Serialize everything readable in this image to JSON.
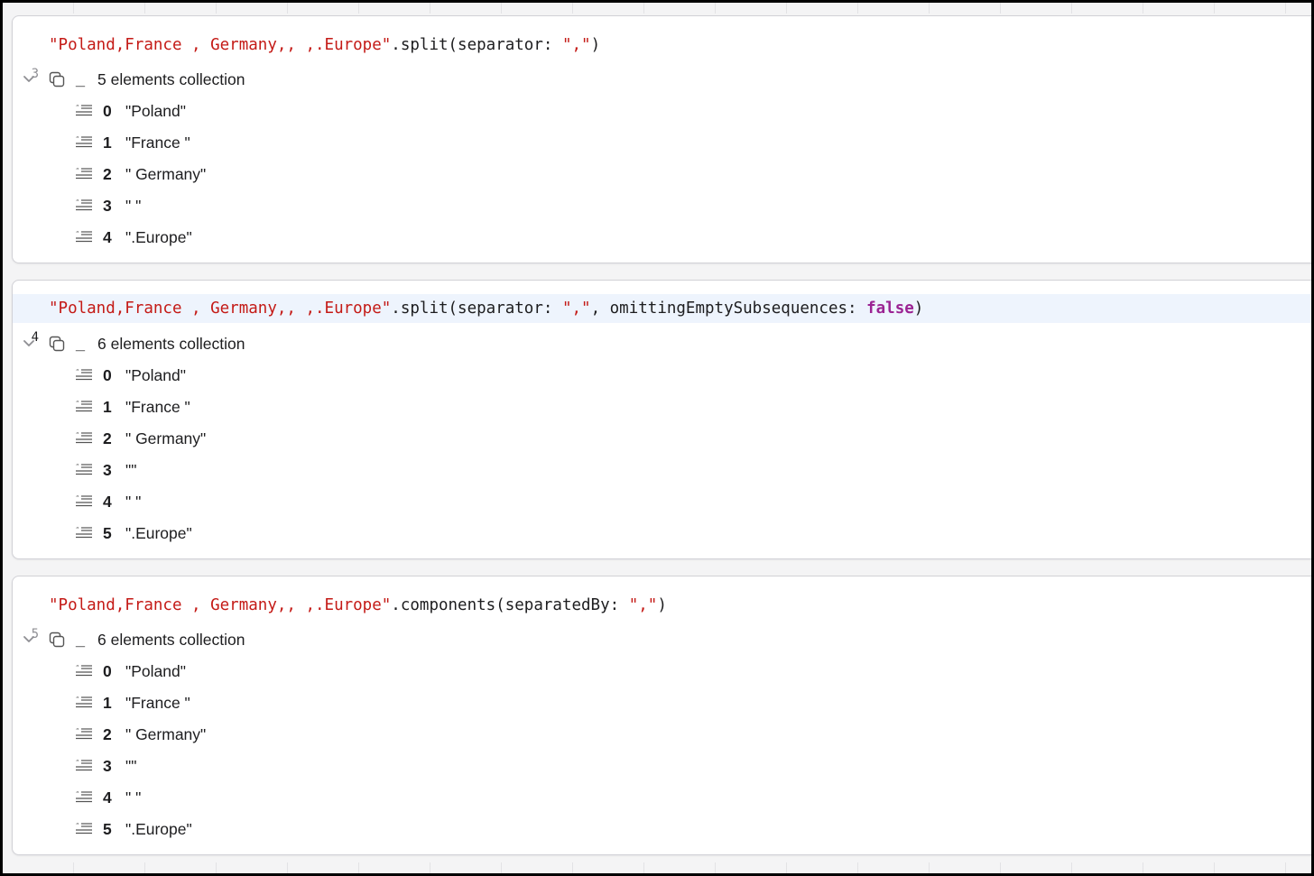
{
  "blocks": [
    {
      "line_number": "3",
      "code": {
        "literal": "\"Poland,France , Germany,, ,.Europe\"",
        "method": ".split(separator: ",
        "separator": "\",\"",
        "tail": ")"
      },
      "result": {
        "prefix": "_",
        "label": "5 elements collection",
        "items": [
          {
            "index": "0",
            "value": "\"Poland\""
          },
          {
            "index": "1",
            "value": "\"France \""
          },
          {
            "index": "2",
            "value": "\" Germany\""
          },
          {
            "index": "3",
            "value": "\" \""
          },
          {
            "index": "4",
            "value": "\".Europe\""
          }
        ]
      }
    },
    {
      "line_number": "4",
      "code": {
        "literal": "\"Poland,France , Germany,, ,.Europe\"",
        "method": ".split(separator: ",
        "separator": "\",\"",
        "middle": ", omittingEmptySubsequences: ",
        "keyword": "false",
        "tail": ")"
      },
      "result": {
        "prefix": "_",
        "label": "6 elements collection",
        "items": [
          {
            "index": "0",
            "value": "\"Poland\""
          },
          {
            "index": "1",
            "value": "\"France \""
          },
          {
            "index": "2",
            "value": "\" Germany\""
          },
          {
            "index": "3",
            "value": "\"\""
          },
          {
            "index": "4",
            "value": "\" \""
          },
          {
            "index": "5",
            "value": "\".Europe\""
          }
        ]
      }
    },
    {
      "line_number": "5",
      "code": {
        "literal": "\"Poland,France , Germany,, ,.Europe\"",
        "method": ".components(separatedBy: ",
        "separator": "\",\"",
        "tail": ")"
      },
      "result": {
        "prefix": "_",
        "label": "6 elements collection",
        "items": [
          {
            "index": "0",
            "value": "\"Poland\""
          },
          {
            "index": "1",
            "value": "\"France \""
          },
          {
            "index": "2",
            "value": "\" Germany\""
          },
          {
            "index": "3",
            "value": "\"\""
          },
          {
            "index": "4",
            "value": "\" \""
          },
          {
            "index": "5",
            "value": "\".Europe\""
          }
        ]
      }
    }
  ],
  "colors": {
    "string": "#c41a16",
    "keyword": "#9b2393",
    "highlight_line": "#eef4fd",
    "card_border": "#d1d1d6"
  },
  "icons": {
    "disclosure": "chevron-down-icon",
    "copy": "copy-icon",
    "string_value": "quote-text-icon"
  }
}
